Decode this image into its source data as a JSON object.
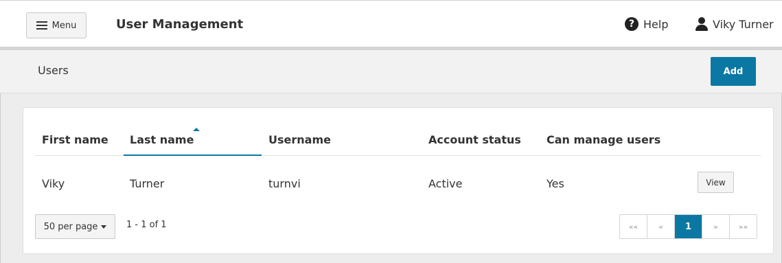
{
  "header": {
    "menu_label": "Menu",
    "title": "User Management",
    "help_label": "Help",
    "user_name": "Viky Turner"
  },
  "subheader": {
    "title": "Users",
    "add_label": "Add"
  },
  "table": {
    "columns": [
      "First name",
      "Last name",
      "Username",
      "Account status",
      "Can manage users"
    ],
    "sorted_column": "Last name",
    "rows": [
      {
        "first_name": "Viky",
        "last_name": "Turner",
        "username": "turnvi",
        "status": "Active",
        "can_manage": "Yes",
        "action": "View"
      }
    ]
  },
  "footer": {
    "per_page": "50 per page",
    "range": "1 - 1 of 1",
    "pagination": {
      "first": "«« ",
      "prev": "«",
      "current": "1",
      "next": "»",
      "last": "»»"
    }
  },
  "colors": {
    "accent": "#0b78a3"
  }
}
